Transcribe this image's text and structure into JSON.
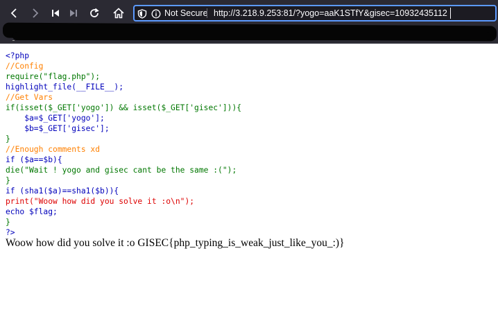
{
  "browser": {
    "security_label": "Not Secure",
    "url": "http://3.218.9.253:81/?yogo=aaK1STfY&gisec=10932435112",
    "icons": [
      "back-arrow-icon",
      "forward-arrow-icon",
      "skip-back-icon",
      "skip-forward-icon",
      "reload-icon",
      "home-icon",
      "shield-icon",
      "info-icon"
    ]
  },
  "code": {
    "lines": [
      [
        {
          "t": "<?php",
          "c": "tag"
        }
      ],
      [
        {
          "t": "//Config",
          "c": "com"
        }
      ],
      [
        {
          "t": "require(\"flag.php\");",
          "c": "kw"
        }
      ],
      [
        {
          "t": "highlight_file(__FILE__);",
          "c": "def"
        }
      ],
      [
        {
          "t": "//Get Vars",
          "c": "com"
        }
      ],
      [
        {
          "t": "if(isset($_GET['yogo']) && isset($_GET['gisec'])){",
          "c": "kw"
        }
      ],
      [
        {
          "t": "    $a=$_GET['yogo'];",
          "c": "def"
        }
      ],
      [
        {
          "t": "    $b=$_GET['gisec'];",
          "c": "def"
        }
      ],
      [
        {
          "t": "}",
          "c": "kw"
        }
      ],
      [
        {
          "t": "//Enough comments xd",
          "c": "com"
        }
      ],
      [
        {
          "t": "if ($a==$b){",
          "c": "def"
        }
      ],
      [
        {
          "t": "die(\"Wait ! yogo and gisec cant be the same :(\");",
          "c": "kw"
        }
      ],
      [
        {
          "t": "}",
          "c": "kw"
        }
      ],
      [
        {
          "t": "if (sha1($a)==sha1($b)){",
          "c": "def"
        }
      ],
      [
        {
          "t": "print(\"Woow how did you solve it :o\\n\");",
          "c": "str"
        }
      ],
      [
        {
          "t": "echo $flag;",
          "c": "def"
        }
      ],
      [
        {
          "t": "}",
          "c": "kw"
        }
      ],
      [
        {
          "t": "?>",
          "c": "tag"
        }
      ]
    ]
  },
  "output": "Woow how did you solve it :o GISEC{php_typing_is_weak_just_like_you_:)}",
  "colors": {
    "chrome_bg": "#2b2a33",
    "urlbar_border": "#5c9aff",
    "php_tag": "#0000bb",
    "php_comment": "#ff8000",
    "php_keyword": "#007700",
    "php_default": "#0000bb",
    "php_string": "#dd0000"
  }
}
